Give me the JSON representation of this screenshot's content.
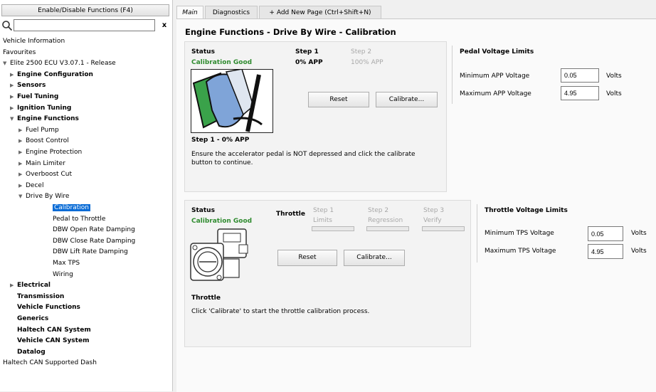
{
  "sidebar": {
    "enable_button": "Enable/Disable Functions (F4)",
    "search": {
      "value": "",
      "placeholder": ""
    },
    "clear": "x",
    "tree": [
      {
        "label": "Vehicle Information",
        "level": 0,
        "arrow": "",
        "bold": false
      },
      {
        "label": "Favourites",
        "level": 0,
        "arrow": "",
        "bold": false
      },
      {
        "label": "Elite 2500 ECU V3.07.1 - Release",
        "level": 0,
        "arrow": "open",
        "bold": false
      },
      {
        "label": "Engine Configuration",
        "level": 1,
        "arrow": "closed",
        "bold": true
      },
      {
        "label": "Sensors",
        "level": 1,
        "arrow": "closed",
        "bold": true
      },
      {
        "label": "Fuel Tuning",
        "level": 1,
        "arrow": "closed",
        "bold": true
      },
      {
        "label": "Ignition Tuning",
        "level": 1,
        "arrow": "closed",
        "bold": true
      },
      {
        "label": "Engine Functions",
        "level": 1,
        "arrow": "open",
        "bold": true
      },
      {
        "label": "Fuel Pump",
        "level": 2,
        "arrow": "closed",
        "bold": false
      },
      {
        "label": "Boost Control",
        "level": 2,
        "arrow": "closed",
        "bold": false
      },
      {
        "label": "Engine Protection",
        "level": 2,
        "arrow": "closed",
        "bold": false
      },
      {
        "label": "Main Limiter",
        "level": 2,
        "arrow": "closed",
        "bold": false
      },
      {
        "label": "Overboost Cut",
        "level": 2,
        "arrow": "closed",
        "bold": false
      },
      {
        "label": "Decel",
        "level": 2,
        "arrow": "closed",
        "bold": false
      },
      {
        "label": "Drive By Wire",
        "level": 2,
        "arrow": "open",
        "bold": false
      },
      {
        "label": "Calibration",
        "level": 3,
        "arrow": "",
        "bold": false,
        "selected": true
      },
      {
        "label": "Pedal to Throttle",
        "level": 3,
        "arrow": "",
        "bold": false
      },
      {
        "label": "DBW Open Rate Damping",
        "level": 3,
        "arrow": "",
        "bold": false
      },
      {
        "label": "DBW Close Rate Damping",
        "level": 3,
        "arrow": "",
        "bold": false
      },
      {
        "label": "DBW Lift Rate Damping",
        "level": 3,
        "arrow": "",
        "bold": false
      },
      {
        "label": "Max TPS",
        "level": 3,
        "arrow": "",
        "bold": false
      },
      {
        "label": "Wiring",
        "level": 3,
        "arrow": "",
        "bold": false
      },
      {
        "label": "Electrical",
        "level": 1,
        "arrow": "closed",
        "bold": true
      },
      {
        "label": "Transmission",
        "level": 1,
        "arrow": "",
        "bold": true
      },
      {
        "label": "Vehicle Functions",
        "level": 1,
        "arrow": "",
        "bold": true
      },
      {
        "label": "Generics",
        "level": 1,
        "arrow": "",
        "bold": true
      },
      {
        "label": "Haltech CAN System",
        "level": 1,
        "arrow": "",
        "bold": true
      },
      {
        "label": "Vehicle CAN System",
        "level": 1,
        "arrow": "",
        "bold": true
      },
      {
        "label": "Datalog",
        "level": 1,
        "arrow": "",
        "bold": true
      },
      {
        "label": "Haltech CAN Supported Dash",
        "level": 0,
        "arrow": "",
        "bold": false
      }
    ]
  },
  "tabs": [
    {
      "label": "Main",
      "active": true
    },
    {
      "label": "Diagnostics",
      "active": false
    },
    {
      "label": "+ Add New Page (Ctrl+Shift+N)",
      "active": false
    }
  ],
  "page_title": "Engine Functions - Drive By Wire - Calibration",
  "pedal": {
    "status_label": "Status",
    "status_value": "Calibration Good",
    "step1_title": "Step 1",
    "step1_value": "0% APP",
    "step2_title": "Step 2",
    "step2_value": "100% APP",
    "reset": "Reset",
    "calibrate": "Calibrate...",
    "step_heading": "Step 1 - 0% APP",
    "instructions": "Ensure the accelerator pedal is NOT depressed and click the calibrate button to continue.",
    "limits_title": "Pedal Voltage Limits",
    "min_label": "Minimum APP Voltage",
    "min_value": "0.05",
    "max_label": "Maximum APP Voltage",
    "max_value": "4.95",
    "unit": "Volts"
  },
  "throttle": {
    "status_label": "Status",
    "status_value": "Calibration Good",
    "throttle_label": "Throttle",
    "step1_title": "Step 1",
    "step1_sub": "Limits",
    "step2_title": "Step 2",
    "step2_sub": "Regression",
    "step3_title": "Step 3",
    "step3_sub": "Verify",
    "reset": "Reset",
    "calibrate": "Calibrate...",
    "heading": "Throttle",
    "instructions": "Click 'Calibrate' to start the throttle calibration process.",
    "limits_title": "Throttle Voltage Limits",
    "min_label": "Minimum TPS Voltage",
    "min_value": "0.05",
    "max_label": "Maximum TPS Voltage",
    "max_value": "4.95",
    "unit": "Volts"
  },
  "colors": {
    "status_good": "#2f8b2f",
    "selection": "#0a6cd6",
    "pedal_green": "#3aa24a",
    "pedal_blue": "#7fa4d8"
  }
}
